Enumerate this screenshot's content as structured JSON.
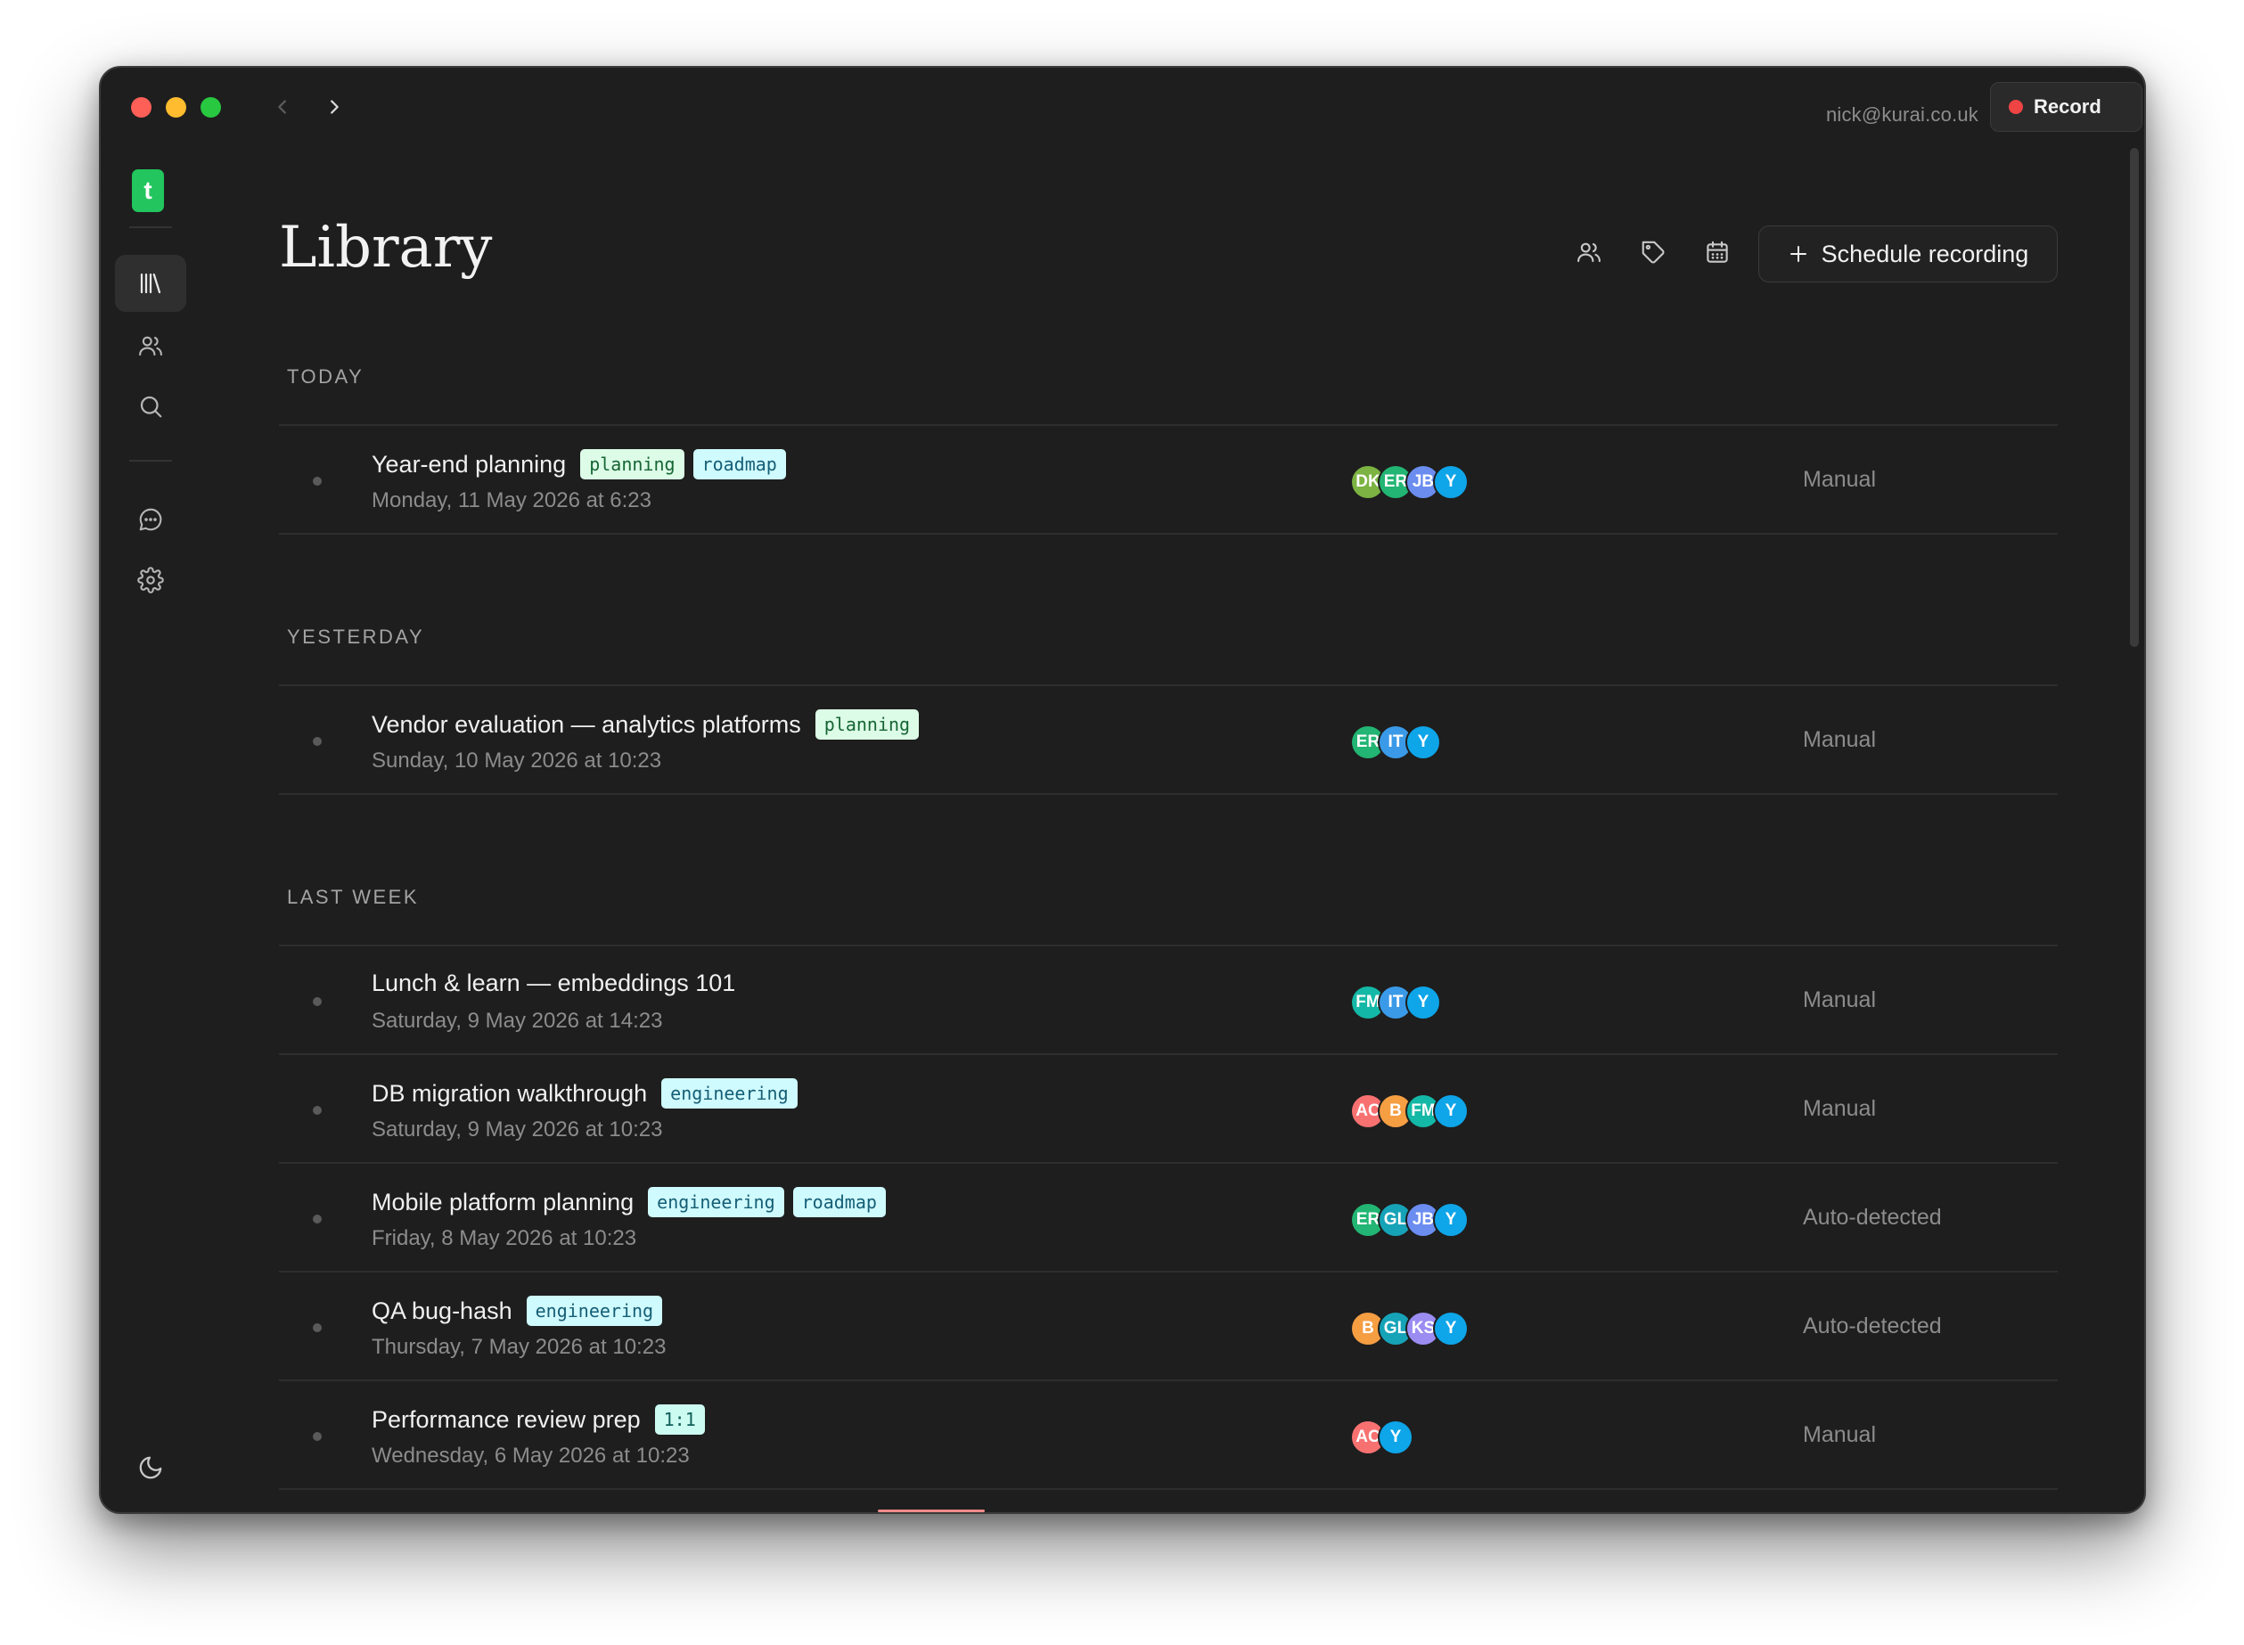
{
  "titlebar": {
    "account_email": "nick@kurai.co.uk",
    "record_label": "Record"
  },
  "sidebar": {
    "logo_letter": "t",
    "items": [
      {
        "name": "library",
        "icon": "library-icon",
        "active": true
      },
      {
        "name": "people",
        "icon": "people-icon",
        "active": false
      },
      {
        "name": "search",
        "icon": "search-icon",
        "active": false
      },
      {
        "name": "chat",
        "icon": "chat-icon",
        "active": false
      },
      {
        "name": "settings",
        "icon": "gear-icon",
        "active": false
      }
    ],
    "bottom_icon": "moon-icon"
  },
  "header": {
    "title": "Library",
    "toolbar_icons": [
      "people-filter-icon",
      "tag-filter-icon",
      "calendar-icon"
    ],
    "schedule_label": "Schedule recording"
  },
  "sections": [
    {
      "label": "TODAY",
      "rows": [
        {
          "title": "Year-end planning",
          "date": "Monday, 11 May 2026 at 6:23",
          "tags": [
            {
              "text": "planning",
              "kind": "planning"
            },
            {
              "text": "roadmap",
              "kind": "roadmap"
            }
          ],
          "avatars": [
            {
              "text": "DK",
              "color": "#7cb342"
            },
            {
              "text": "ER",
              "color": "#22b573"
            },
            {
              "text": "JB",
              "color": "#6b8df0"
            },
            {
              "text": "Y",
              "color": "#0ea5e9"
            }
          ],
          "source": "Manual"
        }
      ]
    },
    {
      "label": "YESTERDAY",
      "rows": [
        {
          "title": "Vendor evaluation — analytics platforms",
          "date": "Sunday, 10 May 2026 at 10:23",
          "tags": [
            {
              "text": "planning",
              "kind": "planning"
            }
          ],
          "avatars": [
            {
              "text": "ER",
              "color": "#22b573"
            },
            {
              "text": "IT",
              "color": "#3b9ae8"
            },
            {
              "text": "Y",
              "color": "#0ea5e9"
            }
          ],
          "source": "Manual"
        }
      ]
    },
    {
      "label": "LAST WEEK",
      "rows": [
        {
          "title": "Lunch & learn — embeddings 101",
          "date": "Saturday, 9 May 2026 at 14:23",
          "tags": [],
          "avatars": [
            {
              "text": "FM",
              "color": "#14b8a6"
            },
            {
              "text": "IT",
              "color": "#3b9ae8"
            },
            {
              "text": "Y",
              "color": "#0ea5e9"
            }
          ],
          "source": "Manual"
        },
        {
          "title": "DB migration walkthrough",
          "date": "Saturday, 9 May 2026 at 10:23",
          "tags": [
            {
              "text": "engineering",
              "kind": "engineering"
            }
          ],
          "avatars": [
            {
              "text": "AC",
              "color": "#f87171"
            },
            {
              "text": "B",
              "color": "#f59e42"
            },
            {
              "text": "FM",
              "color": "#14b8a6"
            },
            {
              "text": "Y",
              "color": "#0ea5e9"
            }
          ],
          "source": "Manual"
        },
        {
          "title": "Mobile platform planning",
          "date": "Friday, 8 May 2026 at 10:23",
          "tags": [
            {
              "text": "engineering",
              "kind": "engineering"
            },
            {
              "text": "roadmap",
              "kind": "roadmap"
            }
          ],
          "avatars": [
            {
              "text": "ER",
              "color": "#22b573"
            },
            {
              "text": "GL",
              "color": "#16a3b8"
            },
            {
              "text": "JB",
              "color": "#6b8df0"
            },
            {
              "text": "Y",
              "color": "#0ea5e9"
            }
          ],
          "source": "Auto-detected"
        },
        {
          "title": "QA bug-hash",
          "date": "Thursday, 7 May 2026 at 10:23",
          "tags": [
            {
              "text": "engineering",
              "kind": "engineering"
            }
          ],
          "avatars": [
            {
              "text": "B",
              "color": "#f59e42"
            },
            {
              "text": "GL",
              "color": "#16a3b8"
            },
            {
              "text": "KS",
              "color": "#9b8cf2"
            },
            {
              "text": "Y",
              "color": "#0ea5e9"
            }
          ],
          "source": "Auto-detected"
        },
        {
          "title": "Performance review prep",
          "date": "Wednesday, 6 May 2026 at 10:23",
          "tags": [
            {
              "text": "1:1",
              "kind": "one"
            }
          ],
          "avatars": [
            {
              "text": "AC",
              "color": "#f87171"
            },
            {
              "text": "Y",
              "color": "#0ea5e9"
            }
          ],
          "source": "Manual"
        }
      ]
    }
  ]
}
